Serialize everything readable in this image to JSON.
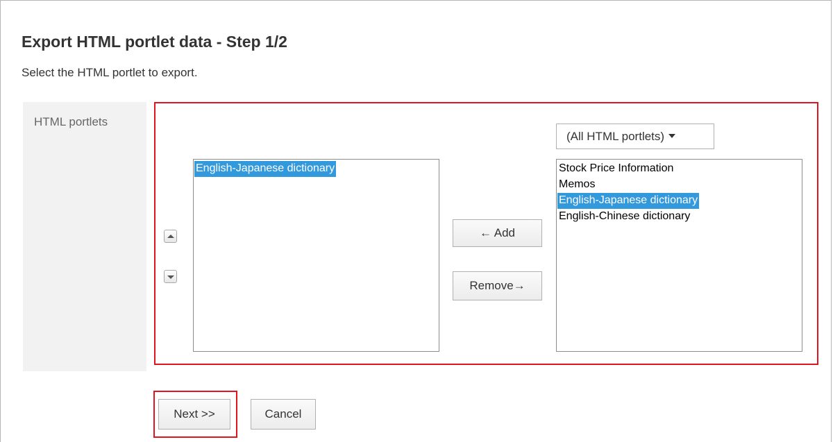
{
  "page": {
    "title": "Export HTML portlet data - Step 1/2",
    "description": "Select the HTML portlet to export."
  },
  "form": {
    "field_label": "HTML portlets",
    "selected_list": {
      "items": [
        {
          "label": "English-Japanese dictionary",
          "selected": true
        }
      ]
    },
    "filter_dropdown": {
      "value": "(All HTML portlets)"
    },
    "available_list": {
      "items": [
        {
          "label": "Stock Price Information",
          "selected": false
        },
        {
          "label": "Memos",
          "selected": false
        },
        {
          "label": "English-Japanese dictionary",
          "selected": true
        },
        {
          "label": "English-Chinese dictionary",
          "selected": false
        }
      ]
    },
    "add_label": "← Add",
    "remove_label": "Remove→"
  },
  "actions": {
    "next_label": "Next >>",
    "cancel_label": "Cancel"
  },
  "colors": {
    "highlight_border": "#e0141e",
    "selection_bg": "#3399dd",
    "label_cell_bg": "#f2f2f2"
  },
  "icons": {
    "move_up": "triangle-up-icon",
    "move_down": "triangle-down-icon",
    "dropdown": "caret-down-icon"
  }
}
